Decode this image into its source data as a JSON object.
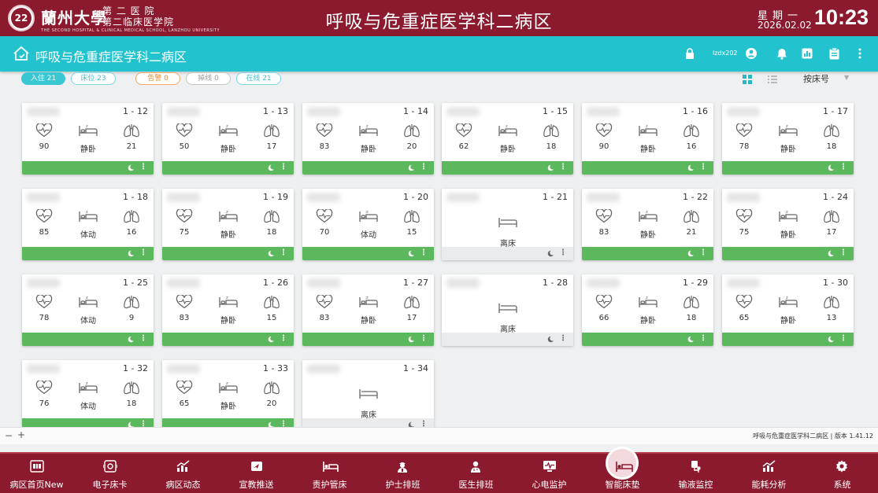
{
  "topbar": {
    "logo_text": "22",
    "university": "蘭州大學",
    "hospital_line1": "第 二 医 院",
    "hospital_line2": "第二临床医学院",
    "hospital_en": "THE SECOND HOSPITAL & CLINICAL MEDICAL SCHOOL, LANZHOU UNIVERSITY",
    "title": "呼吸与危重症医学科二病区",
    "weekday": "星期一",
    "date": "2026.02.02",
    "time": "10:23"
  },
  "subheader": {
    "title": "呼吸与危重症医学科二病区",
    "user": "lzdx202"
  },
  "filters": {
    "admitted": "入住 21",
    "beds": "床位 23",
    "alarm": "告警 0",
    "offline": "掉线 0",
    "online": "在线 21",
    "sort": "按床号"
  },
  "beds": [
    {
      "bed": "1 - 12",
      "hr": "90",
      "posture": "静卧",
      "rr": "21",
      "status": "on"
    },
    {
      "bed": "1 - 13",
      "hr": "50",
      "posture": "静卧",
      "rr": "17",
      "status": "on"
    },
    {
      "bed": "1 - 14",
      "hr": "83",
      "posture": "静卧",
      "rr": "20",
      "status": "on"
    },
    {
      "bed": "1 - 15",
      "hr": "62",
      "posture": "静卧",
      "rr": "18",
      "status": "on"
    },
    {
      "bed": "1 - 16",
      "hr": "90",
      "posture": "静卧",
      "rr": "16",
      "status": "on"
    },
    {
      "bed": "1 - 17",
      "hr": "78",
      "posture": "静卧",
      "rr": "18",
      "status": "on"
    },
    {
      "bed": "1 - 18",
      "hr": "85",
      "posture": "体动",
      "rr": "16",
      "status": "on"
    },
    {
      "bed": "1 - 19",
      "hr": "75",
      "posture": "静卧",
      "rr": "18",
      "status": "on"
    },
    {
      "bed": "1 - 20",
      "hr": "70",
      "posture": "体动",
      "rr": "15",
      "status": "on"
    },
    {
      "bed": "1 - 21",
      "away": "离床",
      "status": "off"
    },
    {
      "bed": "1 - 22",
      "hr": "83",
      "posture": "静卧",
      "rr": "21",
      "status": "on"
    },
    {
      "bed": "1 - 24",
      "hr": "75",
      "posture": "静卧",
      "rr": "17",
      "status": "on"
    },
    {
      "bed": "1 - 25",
      "hr": "78",
      "posture": "体动",
      "rr": "9",
      "status": "on"
    },
    {
      "bed": "1 - 26",
      "hr": "83",
      "posture": "静卧",
      "rr": "15",
      "status": "on"
    },
    {
      "bed": "1 - 27",
      "hr": "83",
      "posture": "静卧",
      "rr": "17",
      "status": "on"
    },
    {
      "bed": "1 - 28",
      "away": "离床",
      "status": "off"
    },
    {
      "bed": "1 - 29",
      "hr": "66",
      "posture": "静卧",
      "rr": "18",
      "status": "on"
    },
    {
      "bed": "1 - 30",
      "hr": "65",
      "posture": "静卧",
      "rr": "13",
      "status": "on"
    },
    {
      "bed": "1 - 32",
      "hr": "76",
      "posture": "体动",
      "rr": "18",
      "status": "on"
    },
    {
      "bed": "1 - 33",
      "hr": "65",
      "posture": "静卧",
      "rr": "20",
      "status": "on"
    },
    {
      "bed": "1 - 34",
      "away": "离床",
      "status": "off"
    }
  ],
  "zoom": {
    "minus": "−",
    "plus": "+"
  },
  "version": "呼吸与危重症医学科二病区 | 版本 1.41.12",
  "nav": [
    {
      "label": "病区首页New",
      "icon": "ward-home-icon"
    },
    {
      "label": "电子床卡",
      "icon": "bed-card-icon"
    },
    {
      "label": "病区动态",
      "icon": "ward-trend-icon"
    },
    {
      "label": "宣教推送",
      "icon": "education-push-icon"
    },
    {
      "label": "责护管床",
      "icon": "bed-management-icon"
    },
    {
      "label": "护士排班",
      "icon": "nurse-schedule-icon"
    },
    {
      "label": "医生排班",
      "icon": "doctor-schedule-icon"
    },
    {
      "label": "心电监护",
      "icon": "ecg-monitor-icon"
    },
    {
      "label": "智能床垫",
      "icon": "smart-mattress-icon",
      "active": true
    },
    {
      "label": "输液监控",
      "icon": "infusion-monitor-icon"
    },
    {
      "label": "能耗分析",
      "icon": "energy-analysis-icon"
    },
    {
      "label": "系统",
      "icon": "system-gear-icon"
    }
  ],
  "colors": {
    "brand": "#8b1a2e",
    "header": "#22c3cf",
    "online_footer": "#5cb85c",
    "offline_footer": "#eaebed"
  }
}
